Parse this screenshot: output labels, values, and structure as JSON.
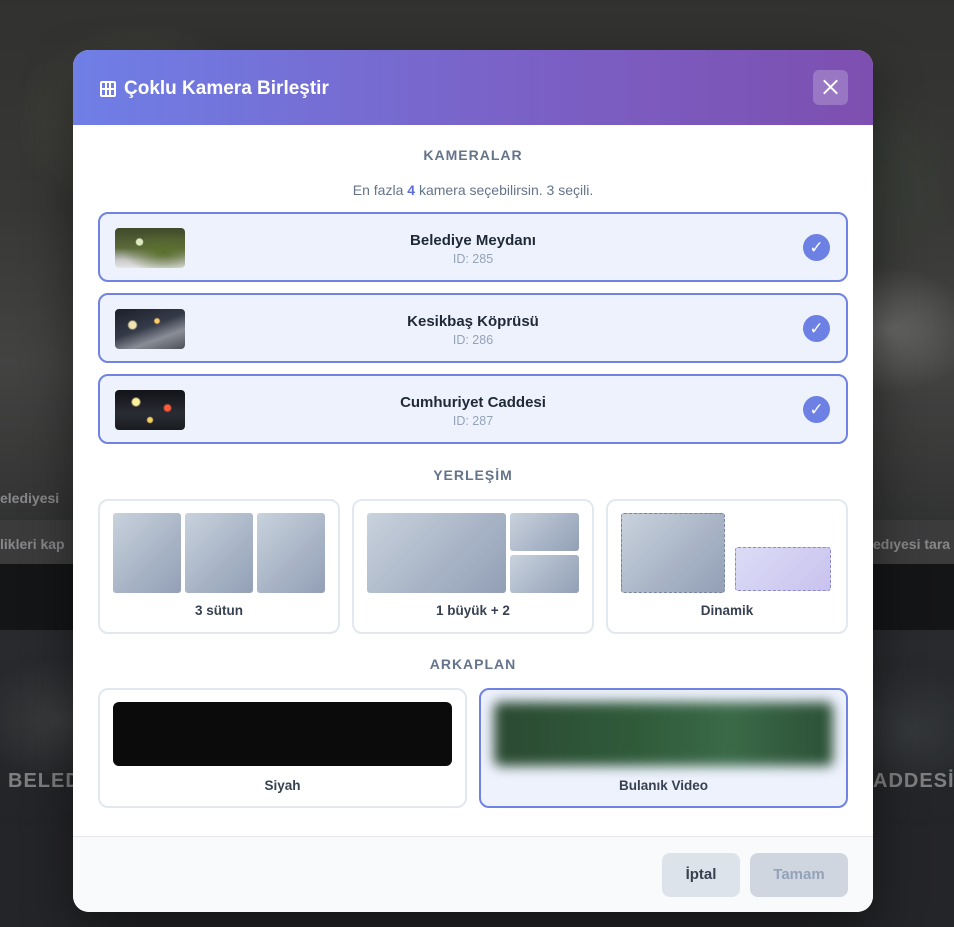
{
  "background": {
    "strip_left": "elediyesi",
    "strip_left2": "likleri kap",
    "strip_right": "edıyesi tara",
    "bottom_left": "BELED",
    "bottom_right": "ADDESİ"
  },
  "modal": {
    "title": "Çoklu Kamera Birleştir",
    "close_icon": "close-icon"
  },
  "cameras": {
    "section_title": "KAMERALAR",
    "hint_prefix": "En fazla",
    "hint_max": "4",
    "hint_suffix": "kamera seçebilirsin. 3 seçili.",
    "items": [
      {
        "name": "Belediye Meydanı",
        "id": "ID: 285",
        "selected": true
      },
      {
        "name": "Kesikbaş Köprüsü",
        "id": "ID: 286",
        "selected": true
      },
      {
        "name": "Cumhuriyet Caddesi",
        "id": "ID: 287",
        "selected": true
      }
    ],
    "check_glyph": "✓"
  },
  "layouts": {
    "section_title": "YERLEŞİM",
    "items": [
      {
        "label": "3 sütun"
      },
      {
        "label": "1 büyük + 2"
      },
      {
        "label": "Dinamik"
      }
    ]
  },
  "backgrounds": {
    "section_title": "ARKAPLAN",
    "items": [
      {
        "label": "Siyah",
        "color": "#0b0b0c",
        "selected": false
      },
      {
        "label": "Bulanık Video",
        "selected": true
      }
    ]
  },
  "footer": {
    "cancel_label": "İptal",
    "ok_label": "Tamam"
  },
  "colors": {
    "accent": "#6d80e4",
    "header_start": "#6f7fe6",
    "header_end": "#7d4fb0"
  }
}
